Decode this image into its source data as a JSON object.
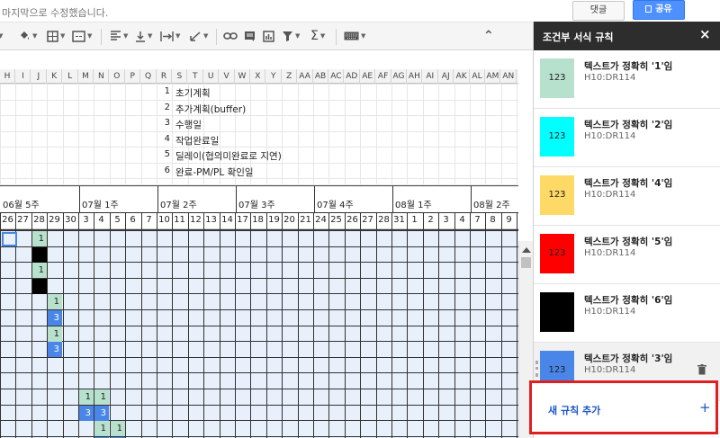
{
  "topbar": {
    "saved_text": "마지막으로 수정했습니다.",
    "comment_label": "댓글",
    "share_label": "공유"
  },
  "toolbar": {
    "icons": [
      "paint-format-icon",
      "borders-icon",
      "merge-cells-icon",
      "align-left-icon",
      "valign-bottom-icon",
      "text-wrap-icon",
      "text-rotate-icon",
      "link-icon",
      "comment-icon",
      "chart-icon",
      "filter-icon",
      "sum-icon",
      "keyboard-icon",
      "collapse-icon"
    ],
    "sum_symbol": "Σ",
    "collapse_symbol": "⌃"
  },
  "columns": [
    "H",
    "I",
    "J",
    "K",
    "L",
    "M",
    "N",
    "O",
    "P",
    "Q",
    "R",
    "S",
    "T",
    "U",
    "V",
    "W",
    "X",
    "Y",
    "Z",
    "AA",
    "AB",
    "AC",
    "AD",
    "AE",
    "AF",
    "AG",
    "AH",
    "AI",
    "AJ",
    "AK",
    "AL",
    "AM",
    "AN"
  ],
  "legend": [
    {
      "num": "1",
      "text": "초기계획"
    },
    {
      "num": "2",
      "text": "추가계획(buffer)"
    },
    {
      "num": "3",
      "text": "수행일"
    },
    {
      "num": "4",
      "text": "작업완료일"
    },
    {
      "num": "5",
      "text": "딜레이(협의미완료로 지연)"
    },
    {
      "num": "6",
      "text": "완료-PM/PL 확인일"
    }
  ],
  "weeks": [
    "06월 5주",
    "07월 1주",
    "07월 2주",
    "07월 3주",
    "07월 4주",
    "08월 1주",
    "08월 2주"
  ],
  "days": [
    "26",
    "27",
    "28",
    "29",
    "30",
    "3",
    "4",
    "5",
    "6",
    "7",
    "10",
    "11",
    "12",
    "13",
    "14",
    "17",
    "18",
    "19",
    "20",
    "21",
    "24",
    "25",
    "26",
    "27",
    "28",
    "31",
    "1",
    "2",
    "3",
    "4",
    "7",
    "8",
    "9"
  ],
  "cells": [
    {
      "col": 2,
      "row": 0,
      "v": "1",
      "color": "#b7e1cd"
    },
    {
      "col": 2,
      "row": 1,
      "v": "",
      "color": "#000000"
    },
    {
      "col": 2,
      "row": 2,
      "v": "1",
      "color": "#b7e1cd"
    },
    {
      "col": 2,
      "row": 3,
      "v": "",
      "color": "#000000"
    },
    {
      "col": 3,
      "row": 4,
      "v": "1",
      "color": "#b7e1cd"
    },
    {
      "col": 3,
      "row": 5,
      "v": "3",
      "color": "#4a86e8"
    },
    {
      "col": 3,
      "row": 6,
      "v": "1",
      "color": "#b7e1cd"
    },
    {
      "col": 3,
      "row": 7,
      "v": "3",
      "color": "#4a86e8"
    },
    {
      "col": 5,
      "row": 10,
      "v": "1",
      "color": "#b7e1cd"
    },
    {
      "col": 6,
      "row": 10,
      "v": "1",
      "color": "#b7e1cd"
    },
    {
      "col": 5,
      "row": 11,
      "v": "3",
      "color": "#4a86e8"
    },
    {
      "col": 6,
      "row": 11,
      "v": "3",
      "color": "#4a86e8"
    },
    {
      "col": 6,
      "row": 12,
      "v": "1",
      "color": "#b7e1cd"
    },
    {
      "col": 7,
      "row": 12,
      "v": "1",
      "color": "#b7e1cd"
    },
    {
      "col": 6,
      "row": 13,
      "v": "",
      "color": "#4a86e8"
    },
    {
      "col": 7,
      "row": 13,
      "v": "",
      "color": "#4a86e8"
    }
  ],
  "panel": {
    "title": "조건부 서식 규칙",
    "close": "×",
    "rules": [
      {
        "swatch_text": "123",
        "swatch_color": "#b7e1cd",
        "text": "텍스트가 정확히 '1'임",
        "range": "H10:DR114"
      },
      {
        "swatch_text": "123",
        "swatch_color": "#00ffff",
        "text": "텍스트가 정확히 '2'임",
        "range": "H10:DR114"
      },
      {
        "swatch_text": "123",
        "swatch_color": "#ffd966",
        "text": "텍스트가 정확히 '4'임",
        "range": "H10:DR114"
      },
      {
        "swatch_text": "123",
        "swatch_color": "#ff0000",
        "text": "텍스트가 정확히 '5'임",
        "range": "H10:DR114"
      },
      {
        "swatch_text": "123",
        "swatch_color": "#000000",
        "text": "텍스트가 정확히 '6'임",
        "range": "H10:DR114"
      },
      {
        "swatch_text": "123",
        "swatch_color": "#4a86e8",
        "text": "텍스트가 정확히 '3'임",
        "range": "H10:DR114"
      }
    ],
    "add_rule": "새 규칙 추가",
    "add_plus": "+"
  }
}
